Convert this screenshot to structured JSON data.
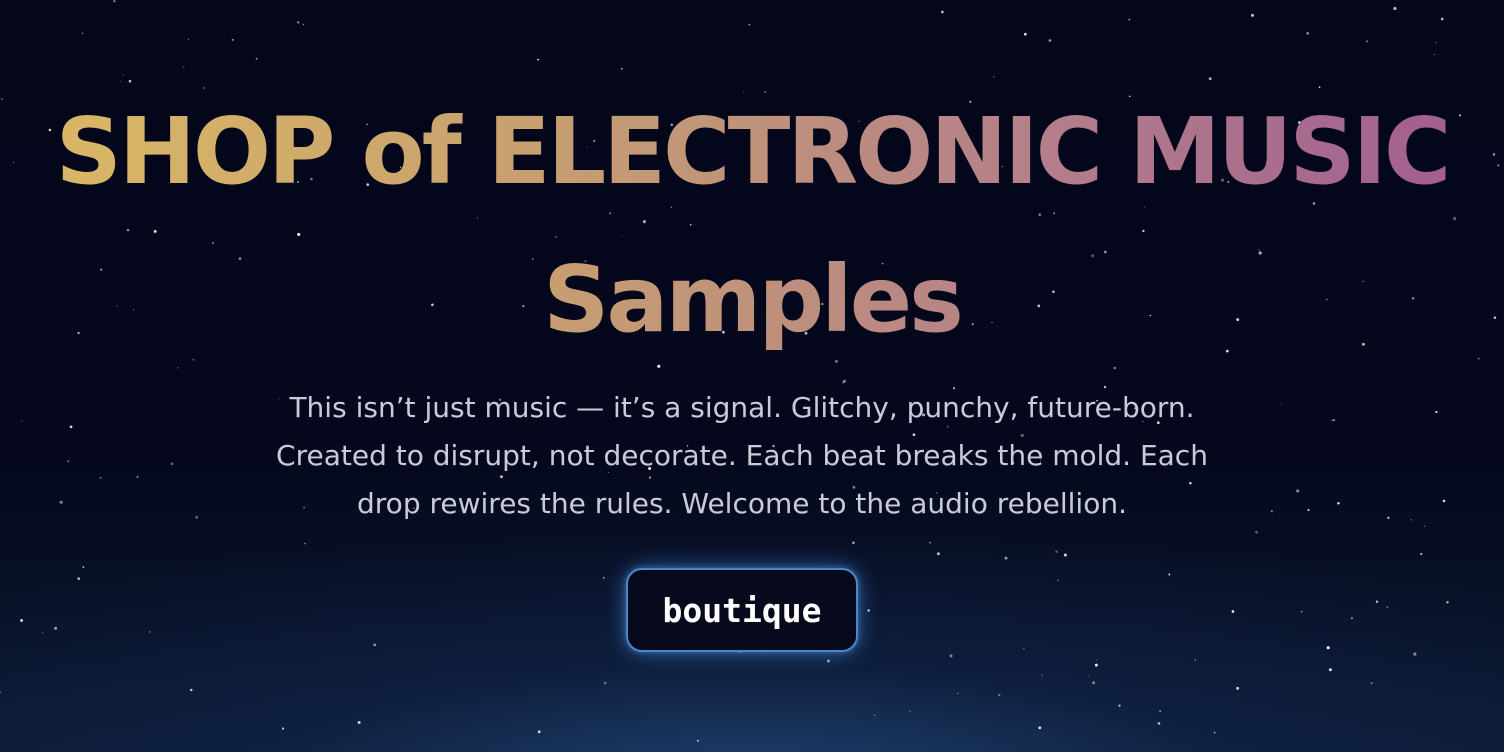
{
  "hero": {
    "title_line1": "SHOP of ELECTRONIC MUSIC",
    "title_line2": "Samples",
    "subtitle": "This isn’t just music — it’s a signal. Glitchy, punchy, future-born. Created to disrupt, not decorate. Each beat breaks the mold. Each drop rewires the rules. Welcome to the audio rebellion.",
    "cta_label": "boutique"
  },
  "colors": {
    "background": "#05071a",
    "title_gradient_start": "#d9b765",
    "title_gradient_end": "#a15f8f",
    "subtitle_text": "#c9cbd6",
    "button_border": "#4a86c8",
    "button_glow": "#468cdc"
  }
}
